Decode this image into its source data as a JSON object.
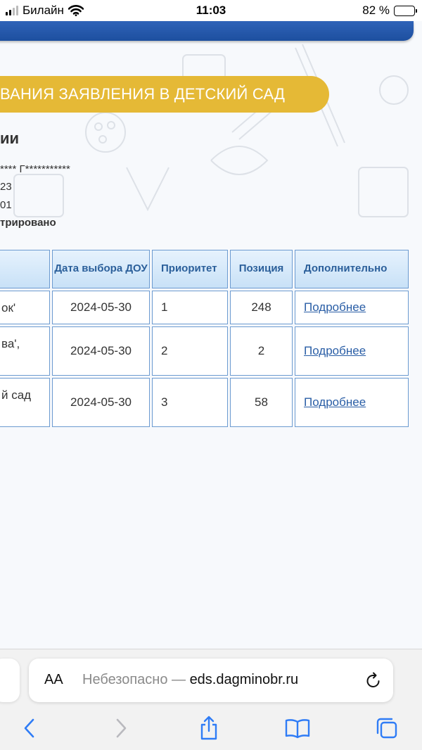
{
  "status_bar": {
    "carrier": "Билайн",
    "time": "11:03",
    "battery_percent": "82 %",
    "battery_level": 0.82
  },
  "banner": {
    "text": "ВАНИЯ ЗАЯВЛЕНИЯ В ДЕТСКИЙ САД"
  },
  "section": {
    "title": "ии",
    "info_lines": [
      "**** Г***********",
      "23",
      "01",
      "трировано"
    ]
  },
  "table": {
    "headers": [
      "",
      "Дата выбора ДОУ",
      "Приоритет",
      "Позиция",
      "Дополнительно"
    ],
    "rows": [
      {
        "name": "ок'",
        "date": "2024-05-30",
        "priority": "1",
        "position": "248",
        "more": "Подробнее"
      },
      {
        "name": "ва',",
        "date": "2024-05-30",
        "priority": "2",
        "position": "2",
        "more": "Подробнее"
      },
      {
        "name": "й сад",
        "date": "2024-05-30",
        "priority": "3",
        "position": "58",
        "more": "Подробнее"
      }
    ]
  },
  "browser": {
    "aa_label": "AA",
    "url_insecure": "Небезопасно — ",
    "url_domain": "eds.dagminobr.ru"
  },
  "icons": {
    "reload": "reload-icon",
    "back": "back-icon",
    "forward": "forward-icon",
    "share": "share-icon",
    "bookmarks": "bookmarks-icon",
    "tabs": "tabs-icon"
  },
  "colors": {
    "header_blue": "#1d4f9f",
    "banner_yellow": "#e5b936",
    "link_blue": "#2a5ea6",
    "ios_blue": "#2f7cf6"
  }
}
